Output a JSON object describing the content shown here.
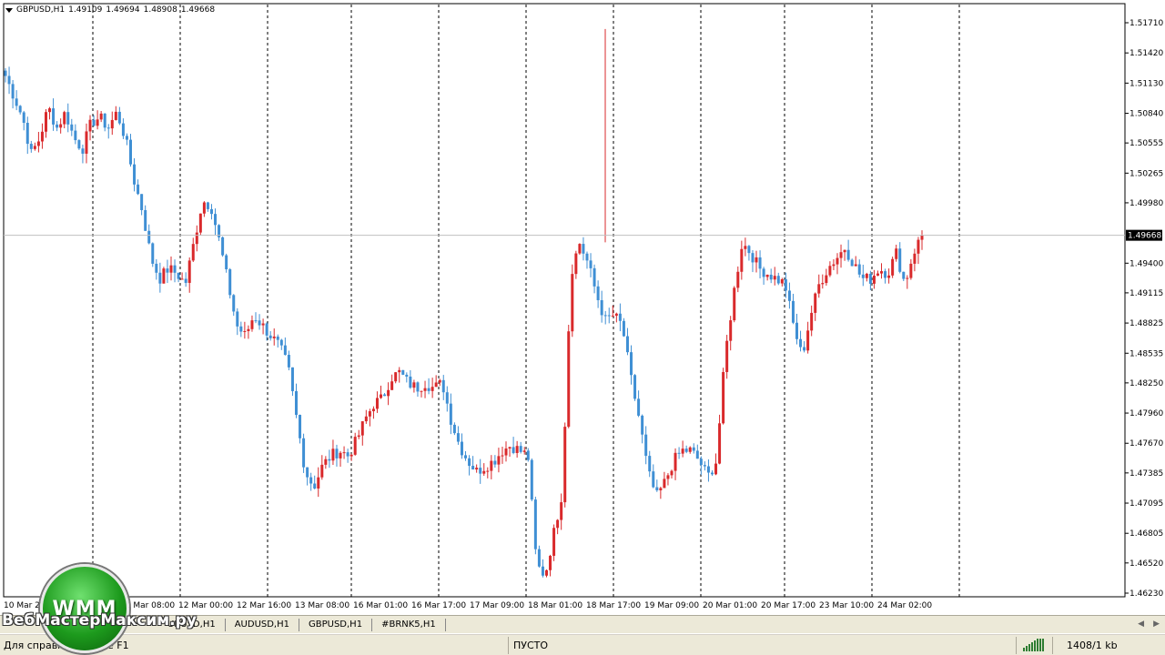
{
  "legend": {
    "symbol": "GBPUSD,H1",
    "open": "1.49109",
    "high": "1.49694",
    "low": "1.48908",
    "close": "1.49668"
  },
  "chart_data": {
    "type": "candlestick",
    "symbol": "GBPUSD,H1",
    "ylim": [
      1.4623,
      1.5171
    ],
    "current_price": 1.49668,
    "current_price_label": "1.49668",
    "y_ticks": [
      "1.51710",
      "1.51420",
      "1.51130",
      "1.50840",
      "1.50555",
      "1.50265",
      "1.49980",
      "1.49400",
      "1.49115",
      "1.48825",
      "1.48535",
      "1.48250",
      "1.47960",
      "1.47670",
      "1.47385",
      "1.47095",
      "1.46805",
      "1.46520",
      "1.46230"
    ],
    "x_ticks": [
      "10 Mar 2015",
      "11 Mar 08:00",
      "12 Mar 00:00",
      "12 Mar 16:00",
      "13 Mar 08:00",
      "16 Mar 01:00",
      "16 Mar 17:00",
      "17 Mar 09:00",
      "18 Mar 01:00",
      "18 Mar 17:00",
      "19 Mar 09:00",
      "20 Mar 01:00",
      "20 Mar 17:00",
      "23 Mar 10:00",
      "24 Mar 02:00"
    ],
    "up_color": "#d9292b",
    "down_color": "#3f8fd4",
    "grid": "vertical-dashed",
    "anchors": [
      1.512,
      1.51,
      1.508,
      1.5045,
      1.506,
      1.509,
      1.507,
      1.5085,
      1.506,
      1.505,
      1.5075,
      1.508,
      1.507,
      1.5085,
      1.506,
      1.502,
      1.499,
      1.4945,
      1.4925,
      1.4935,
      1.493,
      1.492,
      1.496,
      1.5,
      1.4995,
      1.496,
      1.492,
      1.488,
      1.487,
      1.489,
      1.488,
      1.487,
      1.486,
      1.484,
      1.479,
      1.474,
      1.4725,
      1.4745,
      1.4755,
      1.476,
      1.4755,
      1.477,
      1.479,
      1.4805,
      1.481,
      1.483,
      1.4835,
      1.4825,
      1.482,
      1.4825,
      1.482,
      1.4825,
      1.479,
      1.4765,
      1.475,
      1.474,
      1.4745,
      1.475,
      1.476,
      1.4765,
      1.476,
      1.4755,
      1.465,
      1.464,
      1.468,
      1.472,
      1.493,
      1.496,
      1.494,
      1.491,
      1.4885,
      1.489,
      1.488,
      1.483,
      1.479,
      1.474,
      1.4715,
      1.473,
      1.475,
      1.476,
      1.476,
      1.475,
      1.4735,
      1.475,
      1.485,
      1.491,
      1.496,
      1.495,
      1.4935,
      1.493,
      1.4925,
      1.492,
      1.488,
      1.485,
      1.489,
      1.492,
      1.4935,
      1.4945,
      1.4955,
      1.494,
      1.4925,
      1.4925,
      1.4935,
      1.493,
      1.495,
      1.492,
      1.495,
      1.4967
    ]
  },
  "tabs": [
    "URUSD,H1",
    "AUDUSD,H1",
    "GBPUSD,H1",
    "#BRNK5,H1"
  ],
  "status": {
    "help": "Для справки,",
    "help_tail": "e F1",
    "profile": "ПУСТО",
    "traffic": "1408/1 kb"
  },
  "logo": {
    "badge": "WMM",
    "site": "ВебМастерМаксим.ру"
  },
  "colors": {
    "ui_bg": "#ece9d8",
    "grid": "#000000",
    "price_line": "#c0c0c0"
  }
}
